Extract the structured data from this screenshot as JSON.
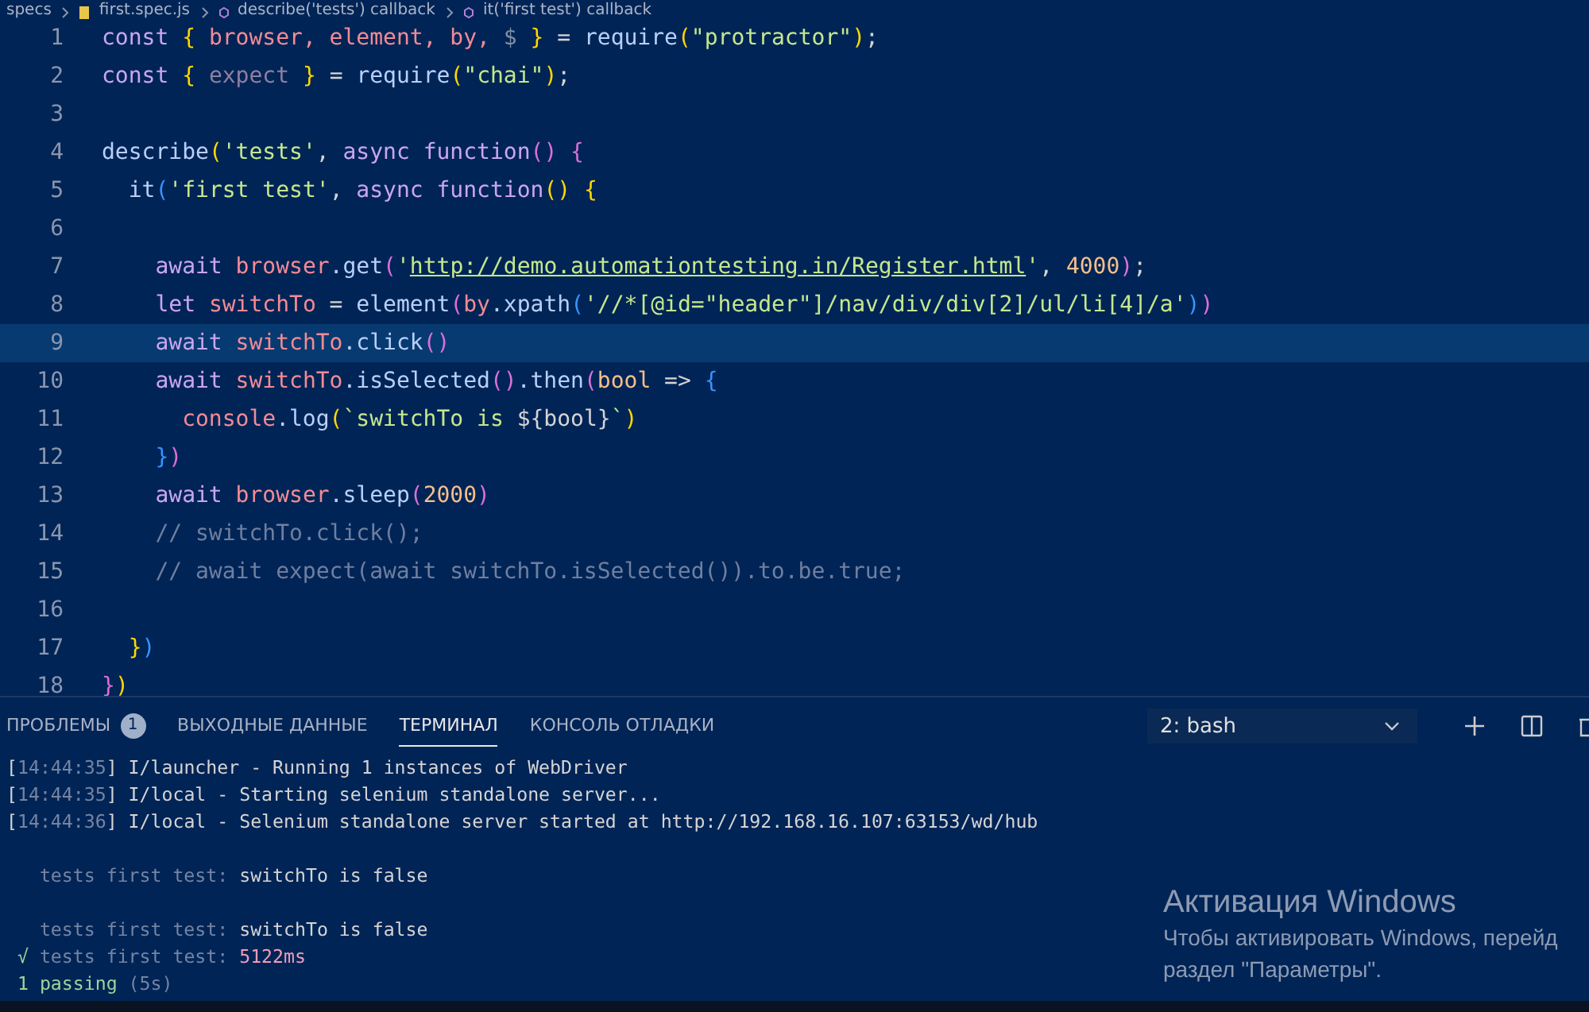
{
  "breadcrumb": [
    {
      "kind": "folder",
      "text": "specs"
    },
    {
      "kind": "file",
      "text": "first.spec.js"
    },
    {
      "kind": "symbol",
      "text": "describe('tests') callback"
    },
    {
      "kind": "symbol",
      "text": "it('first test') callback"
    }
  ],
  "editor": {
    "lines": [
      {
        "number": "1",
        "current": false,
        "tokens": [
          {
            "kind": "kw",
            "text": "const "
          },
          {
            "kind": "b1",
            "text": "{ "
          },
          {
            "kind": "var",
            "text": "browser, "
          },
          {
            "kind": "var",
            "text": "element, "
          },
          {
            "kind": "var",
            "text": "by, "
          },
          {
            "kind": "dim",
            "text": "$ "
          },
          {
            "kind": "b1",
            "text": "}"
          },
          {
            "kind": "p",
            "text": " = "
          },
          {
            "kind": "fn",
            "text": "require"
          },
          {
            "kind": "b1",
            "text": "("
          },
          {
            "kind": "str",
            "text": "\"protractor\""
          },
          {
            "kind": "b1",
            "text": ")"
          },
          {
            "kind": "p",
            "text": ";"
          }
        ]
      },
      {
        "number": "2",
        "current": false,
        "tokens": [
          {
            "kind": "kw",
            "text": "const "
          },
          {
            "kind": "b1",
            "text": "{ "
          },
          {
            "kind": "unused",
            "text": "expect "
          },
          {
            "kind": "b1",
            "text": "}"
          },
          {
            "kind": "p",
            "text": " = "
          },
          {
            "kind": "fn",
            "text": "require"
          },
          {
            "kind": "b1",
            "text": "("
          },
          {
            "kind": "str",
            "text": "\"chai\""
          },
          {
            "kind": "b1",
            "text": ")"
          },
          {
            "kind": "p",
            "text": ";"
          }
        ]
      },
      {
        "number": "3",
        "current": false
      },
      {
        "number": "4",
        "current": false,
        "tokens": [
          {
            "kind": "fn",
            "text": "describe"
          },
          {
            "kind": "b1",
            "text": "("
          },
          {
            "kind": "str",
            "text": "'tests'"
          },
          {
            "kind": "p",
            "text": ", "
          },
          {
            "kind": "kw",
            "text": "async function"
          },
          {
            "kind": "b2",
            "text": "() {"
          }
        ]
      },
      {
        "number": "5",
        "current": false,
        "tokens": [
          {
            "kind": "fn",
            "text": "  it"
          },
          {
            "kind": "b3",
            "text": "("
          },
          {
            "kind": "str",
            "text": "'first test'"
          },
          {
            "kind": "p",
            "text": ", "
          },
          {
            "kind": "kw",
            "text": "async function"
          },
          {
            "kind": "b1",
            "text": "() {"
          }
        ]
      },
      {
        "number": "6",
        "current": false
      },
      {
        "number": "7",
        "current": false,
        "tokens": [
          {
            "kind": "kw",
            "text": "    await "
          },
          {
            "kind": "var",
            "text": "browser"
          },
          {
            "kind": "fn",
            "text": ".get"
          },
          {
            "kind": "b2",
            "text": "("
          },
          {
            "kind": "str",
            "text": "'"
          },
          {
            "kind": "link",
            "text": "http://demo.automationtesting.in/Register.html"
          },
          {
            "kind": "str",
            "text": "'"
          },
          {
            "kind": "p",
            "text": ", "
          },
          {
            "kind": "num",
            "text": "4000"
          },
          {
            "kind": "b2",
            "text": ")"
          },
          {
            "kind": "p",
            "text": ";"
          }
        ]
      },
      {
        "number": "8",
        "current": false,
        "tokens": [
          {
            "kind": "kw",
            "text": "    let "
          },
          {
            "kind": "var",
            "text": "switchTo"
          },
          {
            "kind": "p",
            "text": " = "
          },
          {
            "kind": "fn",
            "text": "element"
          },
          {
            "kind": "b2",
            "text": "("
          },
          {
            "kind": "var",
            "text": "by"
          },
          {
            "kind": "fn",
            "text": ".xpath"
          },
          {
            "kind": "b3",
            "text": "("
          },
          {
            "kind": "str",
            "text": "'//*[@id=\"header\"]/nav/div/div[2]/ul/li[4]/a'"
          },
          {
            "kind": "b3",
            "text": ")"
          },
          {
            "kind": "b2",
            "text": ")"
          }
        ]
      },
      {
        "number": "9",
        "current": true,
        "tokens": [
          {
            "kind": "kw",
            "text": "    await "
          },
          {
            "kind": "var",
            "text": "switchTo"
          },
          {
            "kind": "fn",
            "text": ".click"
          },
          {
            "kind": "b2",
            "text": "()"
          }
        ]
      },
      {
        "number": "10",
        "current": false,
        "tokens": [
          {
            "kind": "kw",
            "text": "    await "
          },
          {
            "kind": "var",
            "text": "switchTo"
          },
          {
            "kind": "fn",
            "text": ".isSelected"
          },
          {
            "kind": "b2",
            "text": "()"
          },
          {
            "kind": "fn",
            "text": ".then"
          },
          {
            "kind": "b2",
            "text": "("
          },
          {
            "kind": "param",
            "text": "bool"
          },
          {
            "kind": "p",
            "text": " => "
          },
          {
            "kind": "b3",
            "text": "{"
          }
        ]
      },
      {
        "number": "11",
        "current": false,
        "tokens": [
          {
            "kind": "var",
            "text": "      console"
          },
          {
            "kind": "fn",
            "text": ".log"
          },
          {
            "kind": "b1",
            "text": "("
          },
          {
            "kind": "str",
            "text": "`switchTo is "
          },
          {
            "kind": "p",
            "text": "${bool}"
          },
          {
            "kind": "str",
            "text": "`"
          },
          {
            "kind": "b1",
            "text": ")"
          }
        ]
      },
      {
        "number": "12",
        "current": false,
        "tokens": [
          {
            "kind": "b3",
            "text": "    }"
          },
          {
            "kind": "b2",
            "text": ")"
          }
        ]
      },
      {
        "number": "13",
        "current": false,
        "tokens": [
          {
            "kind": "kw",
            "text": "    await "
          },
          {
            "kind": "var",
            "text": "browser"
          },
          {
            "kind": "fn",
            "text": ".sleep"
          },
          {
            "kind": "b2",
            "text": "("
          },
          {
            "kind": "num",
            "text": "2000"
          },
          {
            "kind": "b2",
            "text": ")"
          }
        ]
      },
      {
        "number": "14",
        "current": false,
        "tokens": [
          {
            "kind": "comment",
            "text": "    // switchTo.click();"
          }
        ]
      },
      {
        "number": "15",
        "current": false,
        "tokens": [
          {
            "kind": "comment",
            "text": "    // await expect(await switchTo.isSelected()).to.be.true;"
          }
        ]
      },
      {
        "number": "16",
        "current": false
      },
      {
        "number": "17",
        "current": false,
        "tokens": [
          {
            "kind": "b1",
            "text": "  }"
          },
          {
            "kind": "b3",
            "text": ")"
          }
        ]
      },
      {
        "number": "18",
        "current": false,
        "tokens": [
          {
            "kind": "b2",
            "text": "}"
          },
          {
            "kind": "b1",
            "text": ")"
          }
        ]
      }
    ]
  },
  "panel": {
    "tabs": [
      {
        "label": "ПРОБЛЕМЫ",
        "badge": "1",
        "selected": false
      },
      {
        "label": "ВЫХОДНЫЕ ДАННЫЕ",
        "selected": false
      },
      {
        "label": "ТЕРМИНАЛ",
        "selected": true
      },
      {
        "label": "КОНСОЛЬ ОТЛАДКИ",
        "selected": false
      }
    ],
    "terminal_select": {
      "value": "2: bash"
    },
    "terminal": [
      {
        "spaced": false,
        "segments": [
          {
            "kind": "plain",
            "text": "["
          },
          {
            "kind": "dim",
            "text": "14:44:35"
          },
          {
            "kind": "plain",
            "text": "] I/launcher - Running 1 instances of WebDriver"
          }
        ]
      },
      {
        "spaced": false,
        "segments": [
          {
            "kind": "plain",
            "text": "["
          },
          {
            "kind": "dim",
            "text": "14:44:35"
          },
          {
            "kind": "plain",
            "text": "] I/local - Starting selenium standalone server..."
          }
        ]
      },
      {
        "spaced": false,
        "segments": [
          {
            "kind": "plain",
            "text": "["
          },
          {
            "kind": "dim",
            "text": "14:44:36"
          },
          {
            "kind": "plain",
            "text": "] I/local - Selenium standalone server started at http://192.168.16.107:63153/wd/hub"
          }
        ]
      },
      {
        "spaced": true,
        "segments": [
          {
            "kind": "dim",
            "text": "   tests first test:"
          },
          {
            "kind": "plain",
            "text": " switchTo is false"
          }
        ]
      },
      {
        "spaced": true,
        "segments": [
          {
            "kind": "dim",
            "text": "   tests first test:"
          },
          {
            "kind": "plain",
            "text": " switchTo is false"
          }
        ]
      },
      {
        "spaced": false,
        "segments": [
          {
            "kind": "ok",
            "text": " √ "
          },
          {
            "kind": "dim",
            "text": "tests first test: "
          },
          {
            "kind": "slow",
            "text": "5122ms"
          }
        ]
      },
      {
        "spaced": false,
        "segments": [
          {
            "kind": "ok",
            "text": " 1 passing "
          },
          {
            "kind": "dim",
            "text": "(5s)"
          }
        ]
      }
    ]
  },
  "activation": {
    "title": "Активация Windows",
    "lines": [
      "Чтобы активировать Windows, перейд",
      "раздел \"Параметры\"."
    ]
  }
}
